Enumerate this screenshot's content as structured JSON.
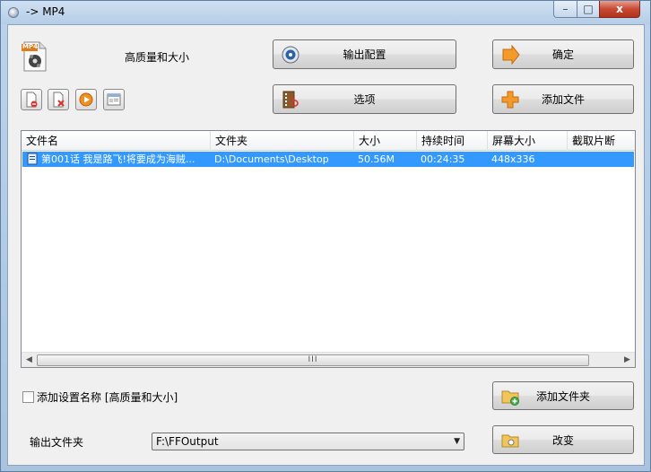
{
  "window": {
    "title": "-> MP4",
    "close_symbol": "x",
    "minimize_symbol": "–",
    "maximize_symbol": "□"
  },
  "format": {
    "icon_label": "MP4",
    "quality_label": "高质量和大小"
  },
  "buttons": {
    "output_config": "输出配置",
    "ok": "确定",
    "options": "选项",
    "add_file": "添加文件",
    "add_folder": "添加文件夹",
    "change": "改变"
  },
  "file_list": {
    "columns": [
      "文件名",
      "文件夹",
      "大小",
      "持续时间",
      "屏幕大小",
      "截取片断"
    ],
    "rows": [
      {
        "name": "第001话 我是路飞!将要成为海贼...",
        "folder": "D:\\Documents\\Desktop",
        "size": "50.56M",
        "duration": "00:24:35",
        "resolution": "448x336",
        "clip": ""
      }
    ],
    "scroll_grip": "III"
  },
  "options": {
    "add_setting_name_label": "添加设置名称 [高质量和大小]",
    "add_setting_name_checked": false
  },
  "output": {
    "label": "输出文件夹",
    "folder": "F:\\FFOutput"
  },
  "colors": {
    "selection": "#3399ff",
    "close_button": "#c74a34"
  }
}
